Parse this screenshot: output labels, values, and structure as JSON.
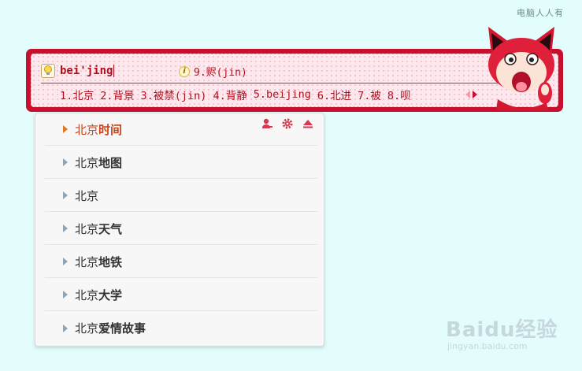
{
  "watermark_top": "电脑人人有",
  "ime": {
    "composition": "bei'jing",
    "hint": "9.赆(jin)",
    "candidates": [
      "1.北京",
      "2.背景",
      "3.被禁(jin)",
      "4.背静",
      "5.beijing",
      "6.北进",
      "7.被",
      "8.呗"
    ]
  },
  "suggestions": {
    "toolbar": [
      "user-icon",
      "gear-icon",
      "eject-icon"
    ],
    "items": [
      {
        "prefix": "北京",
        "suffix": "时间"
      },
      {
        "prefix": "北京",
        "suffix": "地图"
      },
      {
        "prefix": "北京",
        "suffix": ""
      },
      {
        "prefix": "北京",
        "suffix": "天气"
      },
      {
        "prefix": "北京",
        "suffix": "地铁"
      },
      {
        "prefix": "北京",
        "suffix": "大学"
      },
      {
        "prefix": "北京",
        "suffix": "爱情故事"
      }
    ]
  },
  "baidu_watermark": {
    "logo": "Baidu经验",
    "url": "jingyan.baidu.com"
  },
  "colors": {
    "accent": "#c8102e",
    "background": "#e3fdfd",
    "highlight": "#c9441b"
  }
}
